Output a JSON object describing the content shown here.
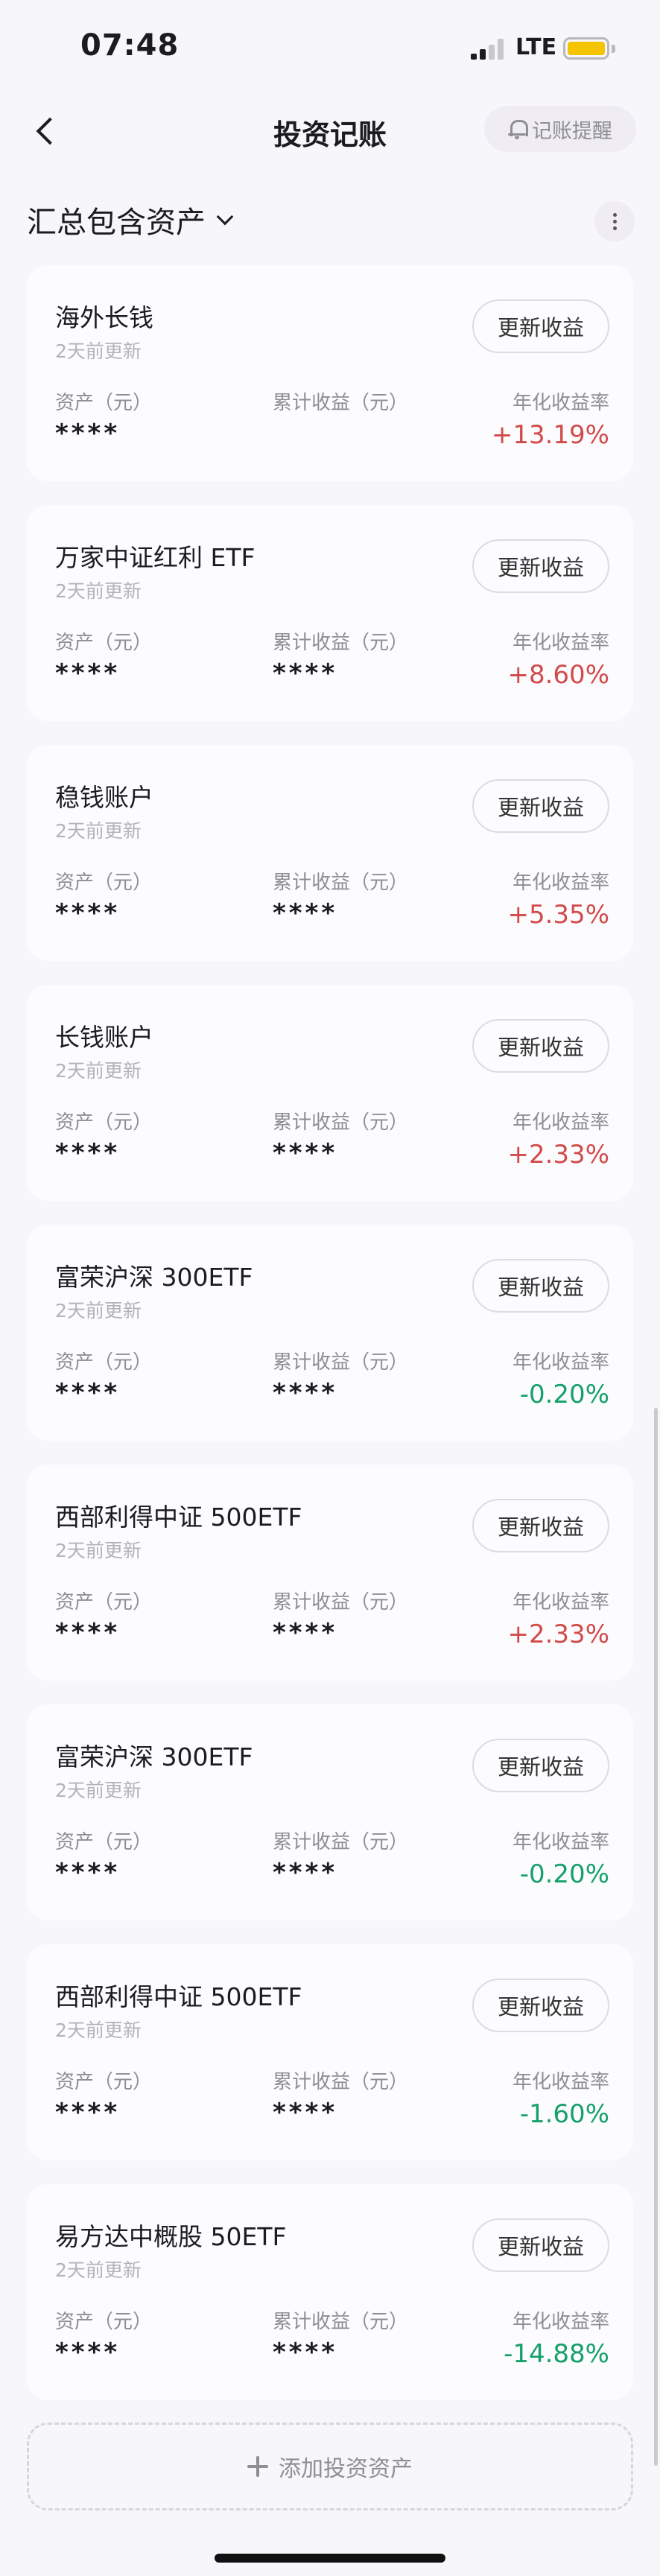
{
  "status_bar": {
    "time": "07:48",
    "network": "LTE"
  },
  "nav": {
    "title": "投资记账",
    "remind_label": "记账提醒"
  },
  "summary": {
    "label": "汇总包含资产"
  },
  "columns": {
    "assets": "资产（元）",
    "cumulative": "累计收益（元）",
    "annualized": "年化收益率"
  },
  "update_label": "更新收益",
  "cards": [
    {
      "name": "海外长钱",
      "updated": "2天前更新",
      "assets": "****",
      "cumulative": "",
      "rate": "+13.19%",
      "trend": "up"
    },
    {
      "name": "万家中证红利 ETF",
      "updated": "2天前更新",
      "assets": "****",
      "cumulative": "****",
      "rate": "+8.60%",
      "trend": "up"
    },
    {
      "name": "稳钱账户",
      "updated": "2天前更新",
      "assets": "****",
      "cumulative": "****",
      "rate": "+5.35%",
      "trend": "up"
    },
    {
      "name": "长钱账户",
      "updated": "2天前更新",
      "assets": "****",
      "cumulative": "****",
      "rate": "+2.33%",
      "trend": "up"
    },
    {
      "name": "富荣沪深 300ETF",
      "updated": "2天前更新",
      "assets": "****",
      "cumulative": "****",
      "rate": "-0.20%",
      "trend": "down"
    },
    {
      "name": "西部利得中证 500ETF",
      "updated": "2天前更新",
      "assets": "****",
      "cumulative": "****",
      "rate": "+2.33%",
      "trend": "up"
    },
    {
      "name": "富荣沪深 300ETF",
      "updated": "2天前更新",
      "assets": "****",
      "cumulative": "****",
      "rate": "-0.20%",
      "trend": "down"
    },
    {
      "name": "西部利得中证 500ETF",
      "updated": "2天前更新",
      "assets": "****",
      "cumulative": "****",
      "rate": "-1.60%",
      "trend": "down"
    },
    {
      "name": "易方达中概股 50ETF",
      "updated": "2天前更新",
      "assets": "****",
      "cumulative": "****",
      "rate": "-14.88%",
      "trend": "down"
    }
  ],
  "add_label": "添加投资资产",
  "colors": {
    "up": "#d24a4a",
    "down": "#16a16a",
    "accent_battery": "#f5c400"
  }
}
